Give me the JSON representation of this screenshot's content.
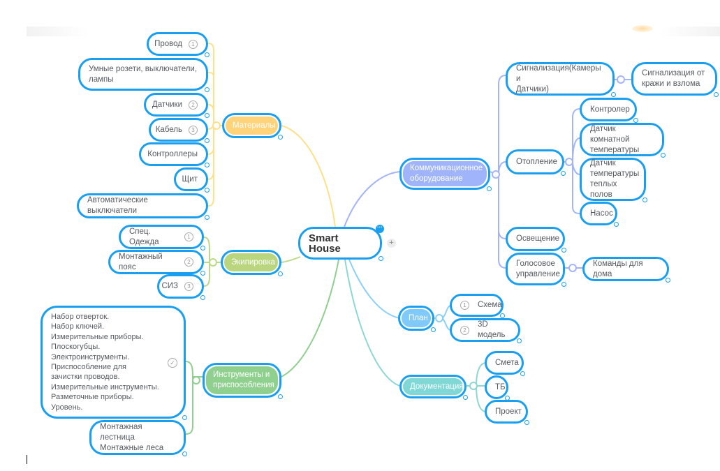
{
  "root": {
    "label": "Smart House",
    "more_icon": "ellipsis-icon",
    "add_icon": "plus-icon",
    "add_glyph": "+"
  },
  "colors": {
    "node_border": "#1a9ff0",
    "materials": "#ffd37a",
    "equipment": "#b9d67f",
    "tools": "#8fd08f",
    "communication": "#9fb4fb",
    "plan": "#7fcafa",
    "documentation": "#7fd8d5",
    "link_materials": "#fde08a",
    "link_equipment": "#bcd98a",
    "link_tools": "#8fcf8f",
    "link_communication": "#a4b4f8",
    "link_plan": "#8cd0f8",
    "link_documentation": "#8dd7d3"
  },
  "branches": {
    "materials": {
      "label": "Материалы",
      "children": [
        {
          "label": "Провод",
          "num": "1"
        },
        {
          "label": "Умные розети, выключатели,\nлампы"
        },
        {
          "label": "Датчики",
          "num": "2"
        },
        {
          "label": "Кабель",
          "num": "3"
        },
        {
          "label": "Контроллеры"
        },
        {
          "label": "Щит"
        },
        {
          "label": "Автоматические выключатели"
        }
      ]
    },
    "equipment": {
      "label": "Экипировка",
      "children": [
        {
          "label": "Спец. Одежда",
          "num": "1"
        },
        {
          "label": "Монтажный пояс",
          "num": "2"
        },
        {
          "label": "СИЗ",
          "num": "3"
        }
      ]
    },
    "tools": {
      "label": "Инструменты и\nприспособления",
      "children": [
        {
          "label": "Набор отверток.\nНабор ключей.\nИзмерительные приборы.\nПлоскогубцы.\nЭлектроинструменты.\nПриспособление для\nзачистки проводов.\nИзмерительные инструменты.\nРазметочные приборы.\nУровень.",
          "icon": "check-circle-icon",
          "glyph": "✓"
        },
        {
          "label": "Монтажная лестница\nМонтажные леса"
        }
      ]
    },
    "communication": {
      "label": "Коммуникационное\nоборудование",
      "children": [
        {
          "label": "Сигнализация(Камеры и\nДатчики)",
          "children": [
            {
              "label": "Сигнализация от\nкражи и взлома"
            }
          ]
        },
        {
          "label": "Отопление",
          "children": [
            {
              "label": "Контролер"
            },
            {
              "label": "Датчик комнатной\nтемпературы"
            },
            {
              "label": "Датчик\nтемпературы\nтеплых полов"
            },
            {
              "label": "Насос"
            }
          ]
        },
        {
          "label": "Освещение"
        },
        {
          "label": "Голосовое\nуправление",
          "children": [
            {
              "label": "Команды для дома"
            }
          ]
        }
      ]
    },
    "plan": {
      "label": "План",
      "children": [
        {
          "label": "Схема",
          "num": "1"
        },
        {
          "label": "3D модель",
          "num": "2"
        }
      ]
    },
    "documentation": {
      "label": "Документация",
      "children": [
        {
          "label": "Смета"
        },
        {
          "label": "ТБ"
        },
        {
          "label": "Проект"
        }
      ]
    }
  }
}
